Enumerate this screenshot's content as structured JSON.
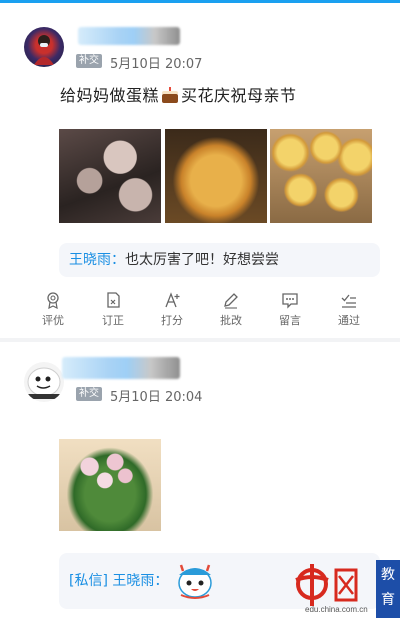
{
  "posts": [
    {
      "tag": "补交",
      "time": "5月10日 20:07",
      "text_before": "给妈妈做蛋糕",
      "text_after": "买花庆祝母亲节",
      "comment": {
        "author": "王晓雨：",
        "text": "也太厉害了吧！好想尝尝"
      }
    },
    {
      "tag": "补交",
      "time": "5月10日 20:04",
      "comment": {
        "prefix": "[私信]",
        "author": "王晓雨："
      }
    }
  ],
  "actions": [
    {
      "label": "评优",
      "icon": "award-icon"
    },
    {
      "label": "订正",
      "icon": "edit-doc-icon"
    },
    {
      "label": "打分",
      "icon": "score-icon"
    },
    {
      "label": "批改",
      "icon": "pencil-icon"
    },
    {
      "label": "留言",
      "icon": "message-icon"
    },
    {
      "label": "通过",
      "icon": "check-list-icon"
    }
  ],
  "watermark": {
    "site": "edu.china.com.cn",
    "edu_chars": [
      "教",
      "育"
    ],
    "logo_char": "中国网"
  },
  "colors": {
    "accent": "#1a8fe3",
    "topbar": "#1aa0f0",
    "edu_box": "#1d4ea8"
  }
}
